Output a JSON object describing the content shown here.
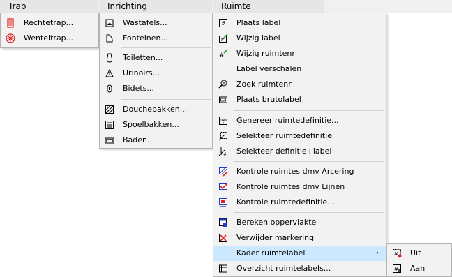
{
  "menubar": {
    "items": [
      {
        "label": "Trap"
      },
      {
        "label": "Inrichting"
      },
      {
        "label": "Ruimte"
      }
    ]
  },
  "trap_menu": {
    "items": [
      {
        "label": "Rechtetrap...",
        "icon": "straight-stair-icon"
      },
      {
        "label": "Wenteltrap...",
        "icon": "spiral-stair-icon"
      }
    ]
  },
  "inrichting_menu": {
    "items": [
      {
        "label": "Wastafels...",
        "icon": "washbasin-icon"
      },
      {
        "label": "Fonteinen...",
        "icon": "fountain-icon"
      },
      {
        "label": "Toiletten...",
        "icon": "toilet-icon"
      },
      {
        "label": "Urinoirs...",
        "icon": "urinal-icon"
      },
      {
        "label": "Bidets...",
        "icon": "bidet-icon"
      },
      {
        "label": "Douchebakken...",
        "icon": "shower-tray-icon"
      },
      {
        "label": "Spoelbakken...",
        "icon": "sink-icon"
      },
      {
        "label": "Baden...",
        "icon": "bathtub-icon"
      }
    ]
  },
  "ruimte_menu": {
    "items": [
      {
        "label": "Plaats label",
        "icon": "place-label-icon"
      },
      {
        "label": "Wijzig label",
        "icon": "edit-label-icon"
      },
      {
        "label": "Wijzig ruimtenr",
        "icon": "edit-room-number-icon"
      },
      {
        "label": "Label verschalen",
        "icon": ""
      },
      {
        "label": "Zoek ruimtenr",
        "icon": "search-room-number-icon"
      },
      {
        "label": "Plaats brutolabel",
        "icon": "gross-label-icon"
      },
      {
        "label": "Genereer ruimtedefinitie...",
        "icon": "generate-definition-icon"
      },
      {
        "label": "Selekteer ruimtedefinitie",
        "icon": "select-definition-icon"
      },
      {
        "label": "Selekteer definitie+label",
        "icon": "select-definition-label-icon"
      },
      {
        "label": "Kontrole ruimtes dmv Arcering",
        "icon": "check-hatch-icon"
      },
      {
        "label": "Kontrole ruimtes dmv Lijnen",
        "icon": "check-lines-icon"
      },
      {
        "label": "Kontrole ruimtedefinitie...",
        "icon": "check-definition-icon"
      },
      {
        "label": "Bereken oppervlakte",
        "icon": "calculate-area-icon"
      },
      {
        "label": "Verwijder markering",
        "icon": "remove-marking-icon"
      },
      {
        "label": "Kader ruimtelabel",
        "icon": "",
        "submenu_arrow": "›"
      },
      {
        "label": "Overzicht ruimtelabels...",
        "icon": "overview-labels-icon"
      }
    ]
  },
  "kader_submenu": {
    "items": [
      {
        "label": "Uit",
        "icon": "frame-off-icon"
      },
      {
        "label": "Aan",
        "icon": "frame-on-icon"
      }
    ]
  },
  "colors": {
    "menubar_bg": "#f0f0f0",
    "menu_bg": "#f2f2f2",
    "highlight": "#cce8ff",
    "icon_red": "#e02020",
    "icon_blue": "#1e3fc0",
    "icon_green": "#1a8a1a"
  }
}
